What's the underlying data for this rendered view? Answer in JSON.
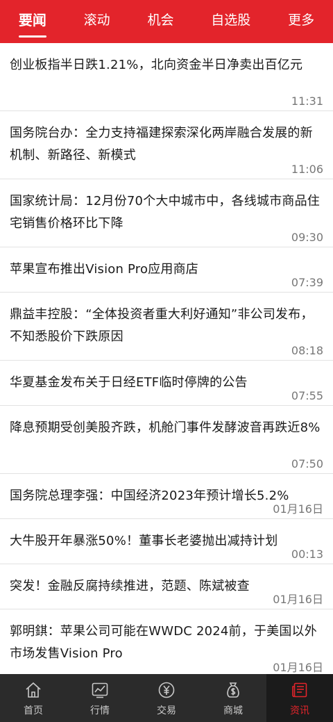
{
  "tabs": [
    {
      "label": "要闻"
    },
    {
      "label": "滚动"
    },
    {
      "label": "机会"
    },
    {
      "label": "自选股"
    },
    {
      "label": "更多"
    }
  ],
  "news": [
    {
      "title": "创业板指半日跌1.21%，北向资金半日净卖出百亿元",
      "time": "11:31"
    },
    {
      "title": "国务院台办：全力支持福建探索深化两岸融合发展的新机制、新路径、新模式",
      "time": "11:06"
    },
    {
      "title": "国家统计局：12月份70个大中城市中，各线城市商品住宅销售价格环比下降",
      "time": "09:30"
    },
    {
      "title": "苹果宣布推出Vision Pro应用商店",
      "time": "07:39"
    },
    {
      "title": "鼎益丰控股：“全体投资者重大利好通知”非公司发布，不知悉股价下跌原因",
      "time": "08:18"
    },
    {
      "title": "华夏基金发布关于日经ETF临时停牌的公告",
      "time": "07:55"
    },
    {
      "title": "降息预期受创美股齐跌，机舱门事件发酵波音再跌近8%",
      "time": "07:50"
    },
    {
      "title": "国务院总理李强：中国经济2023年预计增长5.2%",
      "time": "01月16日"
    },
    {
      "title": "大牛股开年暴涨50%！董事长老婆抛出减持计划",
      "time": "00:13"
    },
    {
      "title": "突发！金融反腐持续推进，范题、陈斌被查",
      "time": "01月16日"
    },
    {
      "title": "郭明錤：苹果公司可能在WWDC 2024前，于美国以外市场发售Vision Pro",
      "time": "01月16日"
    }
  ],
  "bottom_nav": [
    {
      "label": "首页",
      "icon": "home-icon"
    },
    {
      "label": "行情",
      "icon": "chart-icon"
    },
    {
      "label": "交易",
      "icon": "yen-icon"
    },
    {
      "label": "商城",
      "icon": "money-bag-icon"
    },
    {
      "label": "资讯",
      "icon": "news-icon"
    }
  ],
  "colors": {
    "brand": "#e3242b",
    "nav_bg": "#2b2b2b"
  }
}
